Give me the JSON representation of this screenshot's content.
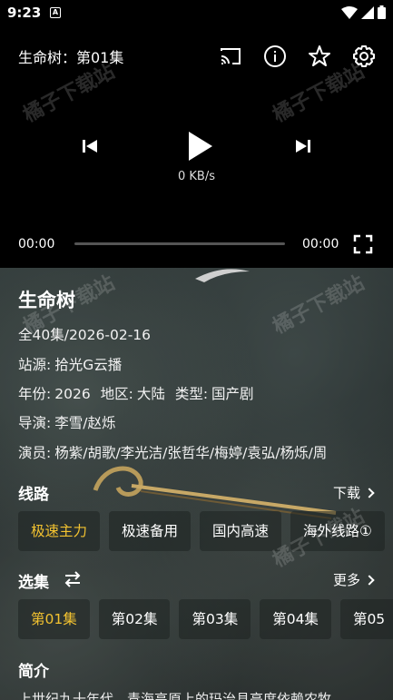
{
  "status": {
    "time": "9:23",
    "app_icon": "A"
  },
  "player": {
    "title": "生命树：第01集",
    "speed": "0 KB/s",
    "time_current": "00:00",
    "time_total": "00:00",
    "progress": 0
  },
  "info": {
    "title": "生命树",
    "episodes": "全40集/2026-02-16",
    "source_label": "站源:",
    "source_value": "拾光G云播",
    "year_label": "年份:",
    "year_value": "2026",
    "region_label": "地区:",
    "region_value": "大陆",
    "genre_label": "类型:",
    "genre_value": "国产剧",
    "director_label": "导演:",
    "director_value": "李雪/赵烁",
    "cast_label": "演员:",
    "cast_value": "杨紫/胡歌/李光洁/张哲华/梅婷/袁弘/杨烁/周"
  },
  "lines": {
    "title": "线路",
    "download_label": "下载",
    "items": [
      "极速主力",
      "极速备用",
      "国内高速",
      "海外线路①"
    ],
    "active_index": 0
  },
  "episodes": {
    "title": "选集",
    "more_label": "更多",
    "items": [
      "第01集",
      "第02集",
      "第03集",
      "第04集",
      "第05"
    ],
    "active_index": 0
  },
  "intro": {
    "title": "简介",
    "text": "上世纪九十年代，青海高原上的玛治县亮度依赖农牧"
  },
  "watermark": "橘子下载站",
  "colors": {
    "accent": "#f2c230",
    "background": "#000000"
  },
  "icons": [
    "cast-icon",
    "info-icon",
    "star-icon",
    "gear-icon",
    "prev-icon",
    "play-icon",
    "next-icon",
    "fullscreen-icon",
    "swap-icon",
    "chevron-right-icon"
  ]
}
